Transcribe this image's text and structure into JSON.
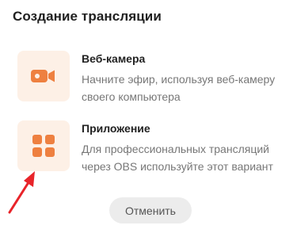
{
  "dialog": {
    "title": "Создание трансляции"
  },
  "options": [
    {
      "title": "Веб-камера",
      "description": "Начните эфир, используя веб-камеру своего компьютера",
      "icon": "video-camera-icon"
    },
    {
      "title": "Приложение",
      "description": "Для профессиональных трансляций через OBS используйте этот вариант",
      "icon": "app-grid-icon"
    }
  ],
  "cancel_label": "Отменить",
  "colors": {
    "accent": "#ee8040",
    "icon_bg": "#fdf0e6",
    "arrow": "#e8242a",
    "button_bg": "#ececec"
  }
}
